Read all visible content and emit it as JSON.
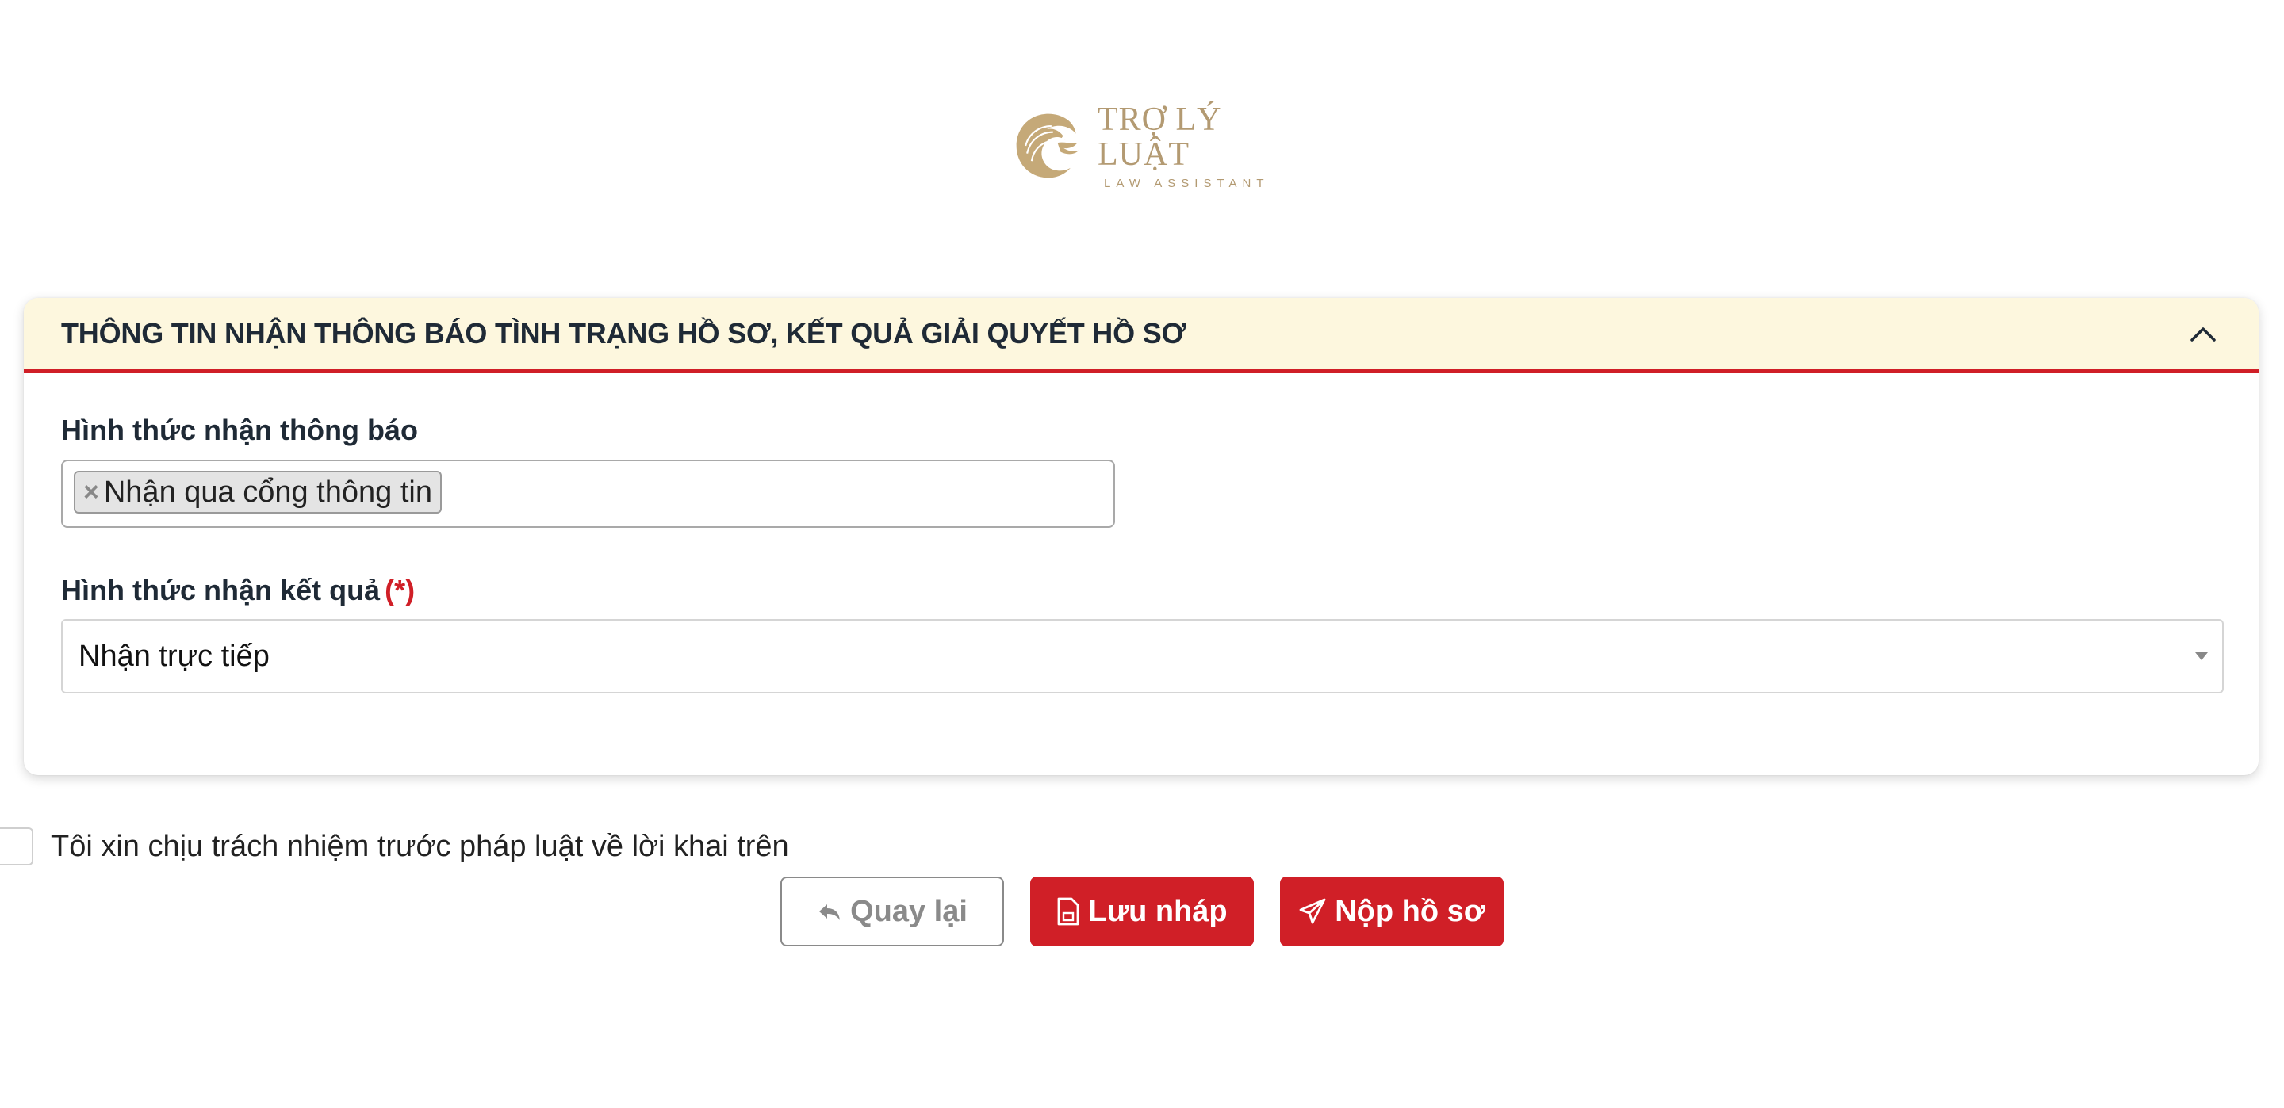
{
  "logo": {
    "title": "TRỢ LÝ LUẬT",
    "subtitle": "LAW ASSISTANT",
    "icon": "eagle-logo-icon",
    "color": "#b39a72"
  },
  "panel": {
    "title": "THÔNG TIN NHẬN THÔNG BÁO TÌNH TRẠNG HỒ SƠ, KẾT QUẢ GIẢI QUYẾT HỒ SƠ",
    "header_bg": "#fdf7de",
    "accent": "#d01f27",
    "collapse_icon": "chevron-up-icon",
    "notification_method": {
      "label": "Hình thức nhận thông báo",
      "selected": [
        "Nhận qua cổng thông tin"
      ],
      "remove_symbol": "×"
    },
    "result_method": {
      "label": "Hình thức nhận kết quả",
      "required_mark": "(*)",
      "value": "Nhận trực tiếp"
    }
  },
  "declaration": {
    "text": "Tôi xin chịu trách nhiệm trước pháp luật về lời khai trên",
    "checked": false
  },
  "buttons": {
    "back": "Quay lại",
    "draft": "Lưu nháp",
    "submit": "Nộp hồ sơ"
  }
}
